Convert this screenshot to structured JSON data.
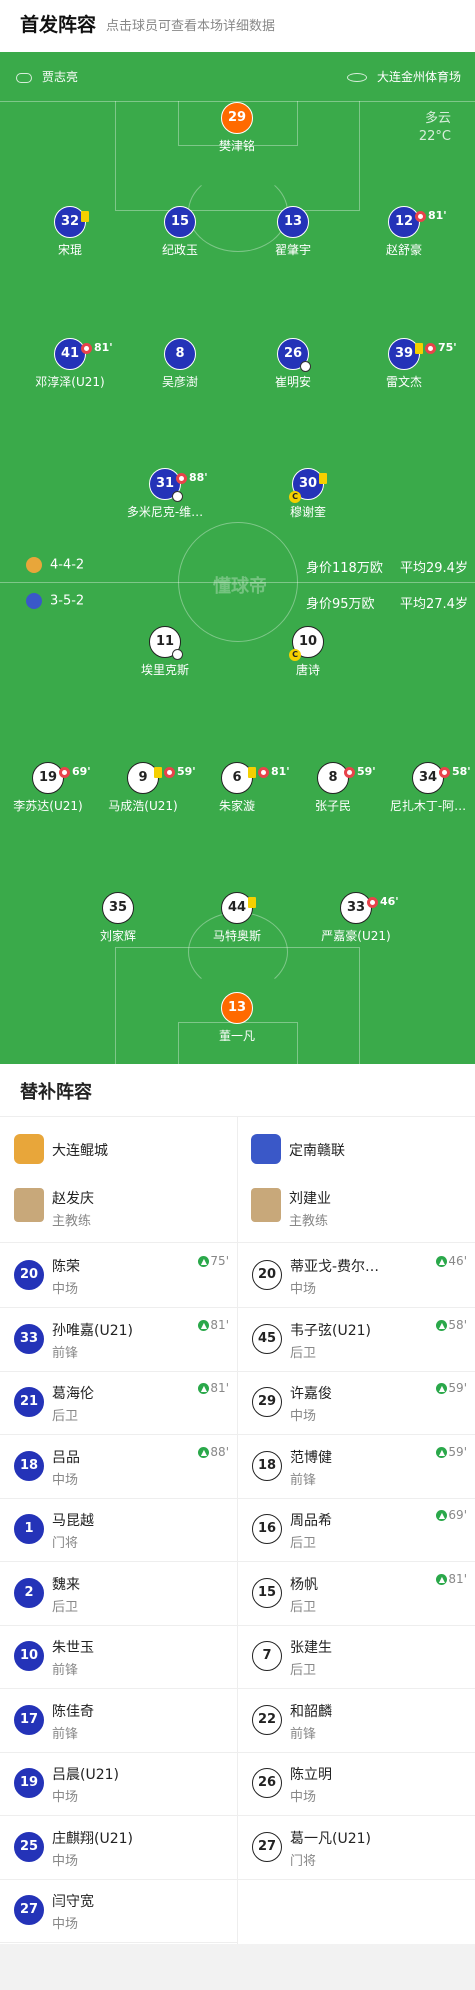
{
  "header": {
    "title": "首发阵容",
    "subtitle": "点击球员可查看本场详细数据"
  },
  "pitch": {
    "referee": "贾志亮",
    "venue": "大连金州体育场",
    "weather": "多云",
    "temperature": "22°C",
    "watermark": "懂球帝",
    "home_formation": "4-4-2",
    "home_value": "身价118万欧",
    "home_age": "平均29.4岁",
    "away_formation": "3-5-2",
    "away_value": "身价95万欧",
    "away_age": "平均27.4岁"
  },
  "home_players": [
    {
      "num": "29",
      "name": "樊津铭",
      "kind": "gk",
      "events": ""
    },
    {
      "num": "32",
      "name": "宋琨",
      "kind": "home",
      "events": "",
      "yc": true
    },
    {
      "num": "15",
      "name": "纪政玉",
      "kind": "home",
      "events": ""
    },
    {
      "num": "13",
      "name": "翟肇宇",
      "kind": "home",
      "events": ""
    },
    {
      "num": "12",
      "name": "赵舒豪",
      "kind": "home",
      "events": "81'",
      "sub": true
    },
    {
      "num": "41",
      "name": "邓淳泽(U21)",
      "kind": "home",
      "events": "81'",
      "sub": true
    },
    {
      "num": "8",
      "name": "吴彦澍",
      "kind": "home",
      "events": ""
    },
    {
      "num": "26",
      "name": "崔明安",
      "kind": "home",
      "events": "",
      "ball": true
    },
    {
      "num": "39",
      "name": "雷文杰",
      "kind": "home",
      "events": "75'",
      "yc": true,
      "sub": true
    },
    {
      "num": "31",
      "name": "多米尼克-维…",
      "kind": "home",
      "events": "88'",
      "sub": true,
      "ball": true
    },
    {
      "num": "30",
      "name": "穆谢奎",
      "kind": "home",
      "events": "",
      "yc": true,
      "capt": true
    }
  ],
  "away_players": [
    {
      "num": "11",
      "name": "埃里克斯",
      "kind": "away",
      "events": "",
      "ball": true
    },
    {
      "num": "10",
      "name": "唐诗",
      "kind": "away",
      "events": "",
      "capt": true
    },
    {
      "num": "19",
      "name": "李苏达(U21)",
      "kind": "away",
      "events": "69'",
      "sub": true
    },
    {
      "num": "9",
      "name": "马成浩(U21)",
      "kind": "away",
      "events": "59'",
      "yc": true,
      "sub": true
    },
    {
      "num": "6",
      "name": "朱家漩",
      "kind": "away",
      "events": "81'",
      "yc": true,
      "sub": true
    },
    {
      "num": "8",
      "name": "张子民",
      "kind": "away",
      "events": "59'",
      "sub": true
    },
    {
      "num": "34",
      "name": "尼扎木丁-阿…",
      "kind": "away",
      "events": "58'",
      "sub": true
    },
    {
      "num": "35",
      "name": "刘家辉",
      "kind": "away",
      "events": ""
    },
    {
      "num": "44",
      "name": "马特奥斯",
      "kind": "away",
      "events": "",
      "yc": true
    },
    {
      "num": "33",
      "name": "严嘉豪(U21)",
      "kind": "away",
      "events": "46'",
      "sub": true
    },
    {
      "num": "13",
      "name": "董一凡",
      "kind": "gk",
      "events": ""
    }
  ],
  "bench": {
    "title": "替补阵容",
    "home_team": "大连鲲城",
    "away_team": "定南赣联",
    "home_coach": "赵发庆",
    "away_coach": "刘建业",
    "coach_role": "主教练",
    "home": [
      {
        "num": "20",
        "name": "陈荣",
        "pos": "中场",
        "time": "75'"
      },
      {
        "num": "33",
        "name": "孙唯嘉(U21)",
        "pos": "前锋",
        "time": "81'"
      },
      {
        "num": "21",
        "name": "葛海伦",
        "pos": "后卫",
        "time": "81'"
      },
      {
        "num": "18",
        "name": "吕品",
        "pos": "中场",
        "time": "88'"
      },
      {
        "num": "1",
        "name": "马昆越",
        "pos": "门将",
        "time": ""
      },
      {
        "num": "2",
        "name": "魏来",
        "pos": "后卫",
        "time": ""
      },
      {
        "num": "10",
        "name": "朱世玉",
        "pos": "前锋",
        "time": ""
      },
      {
        "num": "17",
        "name": "陈佳奇",
        "pos": "前锋",
        "time": ""
      },
      {
        "num": "19",
        "name": "吕晨(U21)",
        "pos": "中场",
        "time": ""
      },
      {
        "num": "25",
        "name": "庄麒翔(U21)",
        "pos": "中场",
        "time": ""
      },
      {
        "num": "27",
        "name": "闫守宽",
        "pos": "中场",
        "time": ""
      }
    ],
    "away": [
      {
        "num": "20",
        "name": "蒂亚戈-费尔…",
        "pos": "中场",
        "time": "46'"
      },
      {
        "num": "45",
        "name": "韦子弦(U21)",
        "pos": "后卫",
        "time": "58'"
      },
      {
        "num": "29",
        "name": "许嘉俊",
        "pos": "中场",
        "time": "59'"
      },
      {
        "num": "18",
        "name": "范博健",
        "pos": "前锋",
        "time": "59'"
      },
      {
        "num": "16",
        "name": "周品希",
        "pos": "后卫",
        "time": "69'"
      },
      {
        "num": "15",
        "name": "杨帆",
        "pos": "后卫",
        "time": "81'"
      },
      {
        "num": "7",
        "name": "张建生",
        "pos": "后卫",
        "time": ""
      },
      {
        "num": "22",
        "name": "和韶麟",
        "pos": "前锋",
        "time": ""
      },
      {
        "num": "26",
        "name": "陈立明",
        "pos": "中场",
        "time": ""
      },
      {
        "num": "27",
        "name": "葛一凡(U21)",
        "pos": "门将",
        "time": ""
      }
    ]
  }
}
